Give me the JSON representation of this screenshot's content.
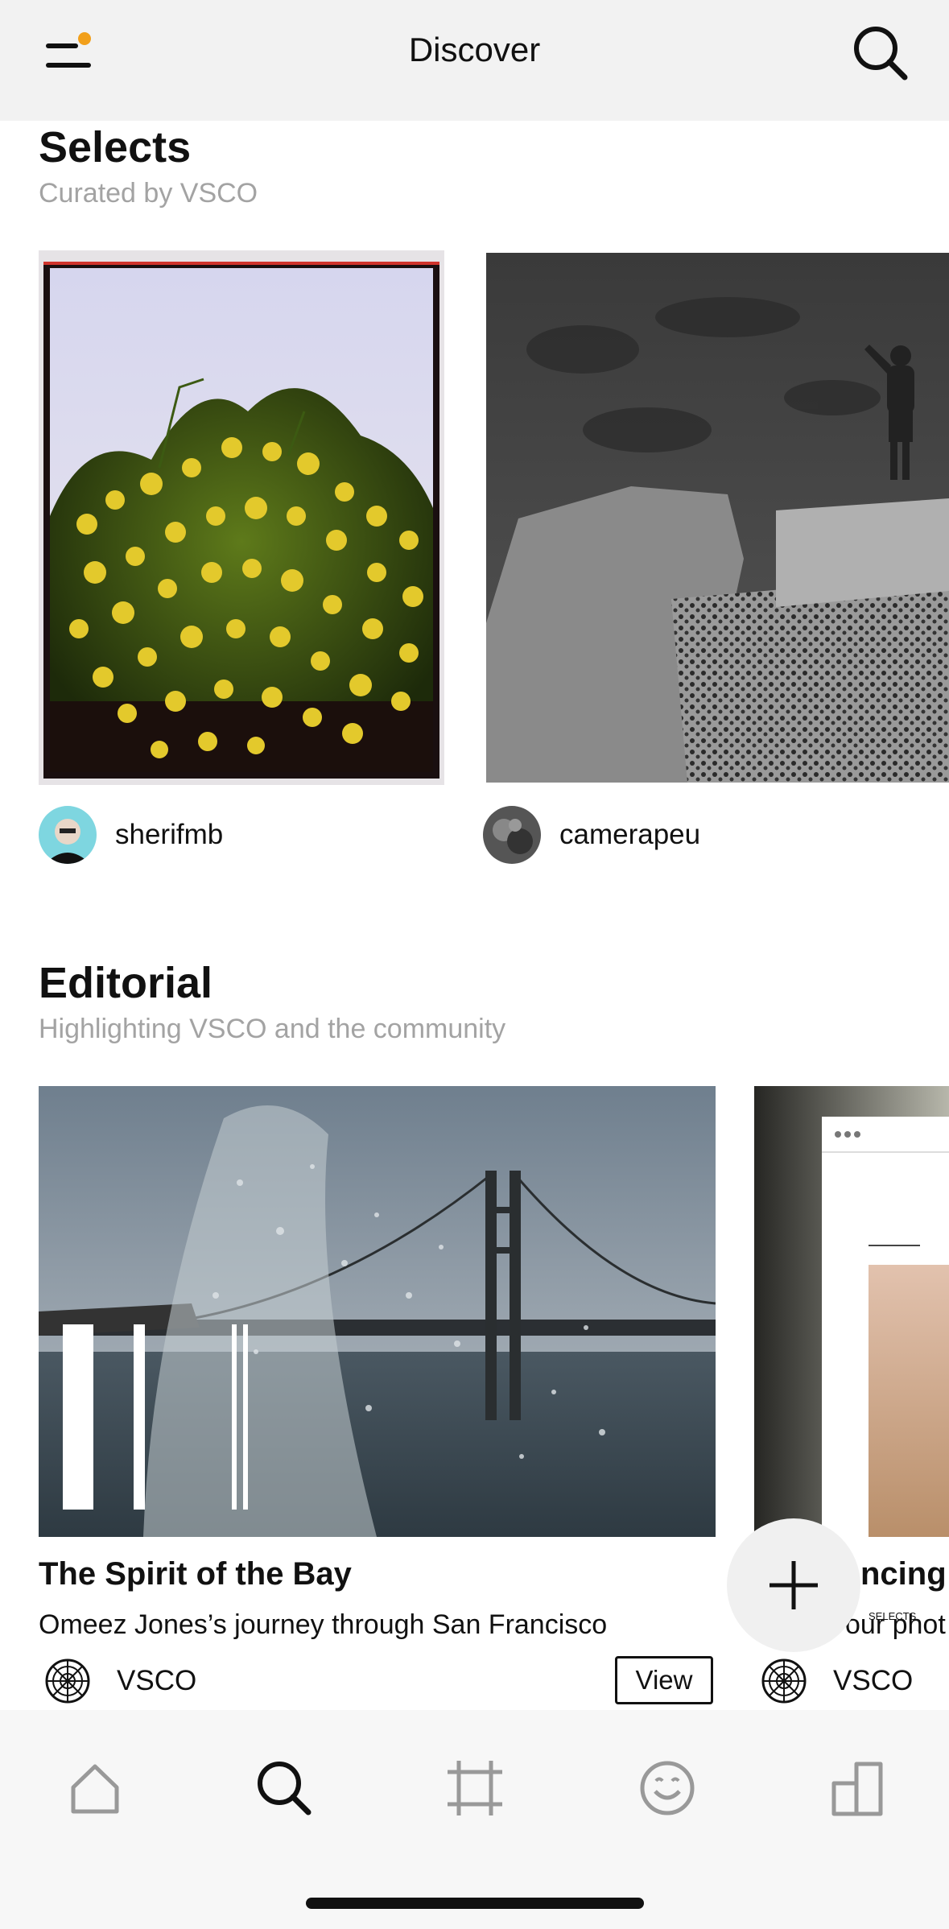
{
  "header": {
    "title": "Discover",
    "menu_badge_color": "#f2a01b"
  },
  "selects": {
    "title": "Selects",
    "subtitle": "Curated by VSCO",
    "cards": [
      {
        "username": "sherifmb",
        "photo": "yellow-flowers"
      },
      {
        "username": "camerapeu",
        "photo": "bw-rocks-swimmer"
      }
    ]
  },
  "editorial": {
    "title": "Editorial",
    "subtitle": "Highlighting VSCO and the community",
    "articles": [
      {
        "title": "The Spirit of the Bay",
        "description": "Omeez Jones’s journey through San Francisco",
        "author": "VSCO",
        "action": "View"
      },
      {
        "title": "ncing V",
        "description": "our phot",
        "author": "VSCO",
        "inner_label": "SELECTS"
      }
    ]
  },
  "fab": {
    "icon": "plus-icon"
  },
  "tabbar": {
    "tabs": [
      {
        "name": "home",
        "icon": "home-icon",
        "active": false
      },
      {
        "name": "discover",
        "icon": "search-icon",
        "active": true
      },
      {
        "name": "studio",
        "icon": "crop-icon",
        "active": false
      },
      {
        "name": "activity",
        "icon": "smiley-icon",
        "active": false
      },
      {
        "name": "profile",
        "icon": "profile-building-icon",
        "active": false
      }
    ]
  }
}
